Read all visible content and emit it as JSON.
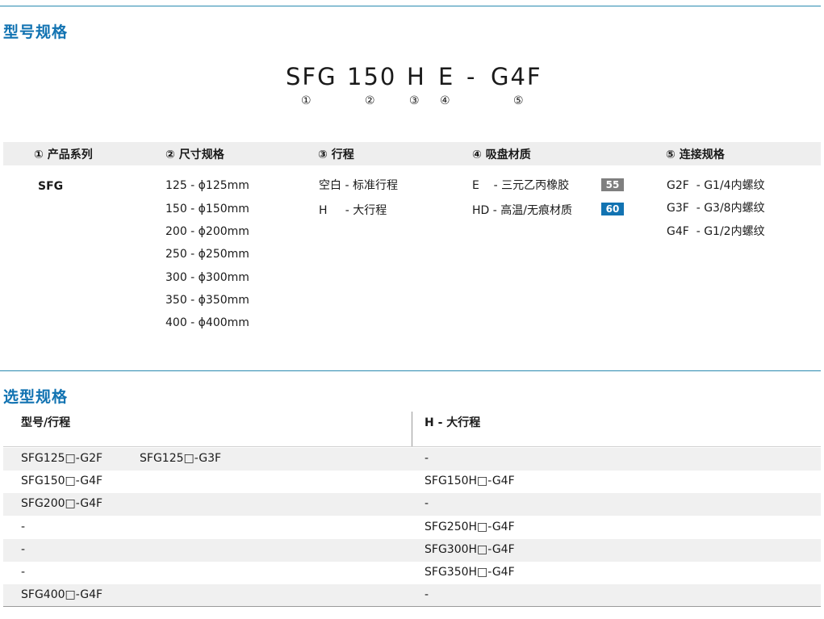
{
  "section1_title": "型号规格",
  "section2_title": "选型规格",
  "model_code": {
    "parts": [
      "SFG",
      "150",
      "H",
      "E",
      "-",
      "G4F"
    ],
    "numbers": [
      "①",
      "②",
      "③",
      "④",
      "⑤"
    ]
  },
  "spec_headers": [
    "① 产品系列",
    "② 尺寸规格",
    "③ 行程",
    "④ 吸盘材质",
    "⑤ 连接规格"
  ],
  "series": [
    "SFG"
  ],
  "sizes": [
    "125 - ϕ125mm",
    "150 - ϕ150mm",
    "200 - ϕ200mm",
    "250 - ϕ250mm",
    "300 - ϕ300mm",
    "350 - ϕ350mm",
    "400 - ϕ400mm"
  ],
  "strokes": [
    "空白 - 标准行程",
    "H     - 大行程"
  ],
  "materials": [
    {
      "label": "E    - 三元乙丙橡胶",
      "badge": "55",
      "badge_color": "#7f7f7f"
    },
    {
      "label": "HD - 高温/无痕材质",
      "badge": "60",
      "badge_color": "#1273b2"
    }
  ],
  "connections": [
    "G2F  - G1/4内螺纹",
    "G3F  - G3/8内螺纹",
    "G4F  - G1/2内螺纹"
  ],
  "selection": {
    "headers": [
      "型号/行程",
      "H - 大行程"
    ],
    "rows": [
      {
        "a": "SFG125□-G2F",
        "a2": "SFG125□-G3F",
        "b": "-"
      },
      {
        "a": "SFG150□-G4F",
        "a2": "",
        "b": "SFG150H□-G4F"
      },
      {
        "a": "SFG200□-G4F",
        "a2": "",
        "b": "-"
      },
      {
        "a": "-",
        "a2": "",
        "b": "SFG250H□-G4F"
      },
      {
        "a": "-",
        "a2": "",
        "b": "SFG300H□-G4F"
      },
      {
        "a": "-",
        "a2": "",
        "b": "SFG350H□-G4F"
      },
      {
        "a": "SFG400□-G4F",
        "a2": "",
        "b": "-"
      }
    ]
  }
}
